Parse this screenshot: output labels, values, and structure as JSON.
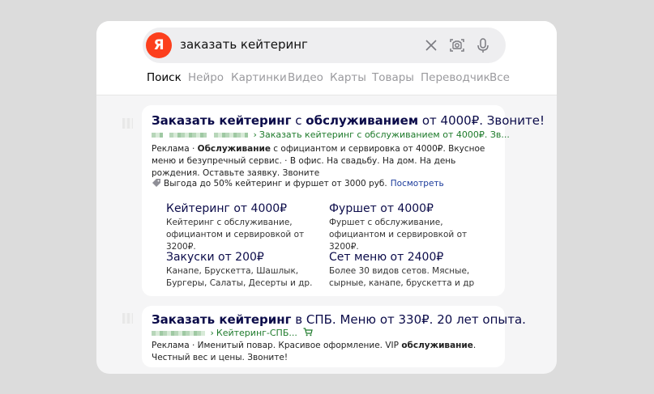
{
  "search": {
    "logo": "Я",
    "query": "заказать кейтеринг"
  },
  "tabs": [
    {
      "label": "Поиск",
      "active": true
    },
    {
      "label": "Нейро"
    },
    {
      "label": "Картинки"
    },
    {
      "label": "Видео"
    },
    {
      "label": "Карты"
    },
    {
      "label": "Товары"
    },
    {
      "label": "Переводчик"
    },
    {
      "label": "Все"
    }
  ],
  "result1": {
    "title_head": "Заказать кейтеринг",
    "title_mid": " с ",
    "title_bold": "обслуживанием",
    "title_tail": " от 4000₽. Звоните!",
    "url_sep": "›",
    "url_path": "Заказать кейтеринг с обслуживанием от 4000₽. Зв...",
    "desc_pre": "Реклама · ",
    "desc_bold": "Обслуживание",
    "desc_post": " с официантом и сервировка от 4000₽. Вкусное меню и безупречный сервис. · В офис. На свадьбу. На дом. На день рождения. Оставьте заявку. Звоните",
    "offer_text": "Выгода до 50% кейтеринг и фуршет от 3000 руб.",
    "offer_link": "Посмотреть",
    "sitelinks": [
      {
        "title": "Кейтеринг от 4000₽",
        "desc": "Кейтеринг с обслуживание, официантом и сервировкой от 3200₽."
      },
      {
        "title": "Фуршет от 4000₽",
        "desc": "Фуршет с обслуживание, официантом и сервировкой от 3200₽."
      },
      {
        "title": "Закуски от 200₽",
        "desc": "Канапе, Брускетта, Шашлык, Бургеры, Салаты, Десерты и др."
      },
      {
        "title": "Сет меню от 2400₽",
        "desc": "Более 30 видов сетов. Мясные, сырные, канапе, брускетта и др"
      }
    ]
  },
  "result2": {
    "title_head": "Заказать кейтеринг",
    "title_tail": " в СПБ. Меню от 330₽. 20 лет опыта.",
    "url_sep": "›",
    "url_path": "Кейтеринг-СПБ...",
    "desc_pre": "Реклама · Именитый повар. Красивое оформление. VIP ",
    "desc_bold": "обслуживание",
    "desc_post": ". Честный вес и цены. Звоните!"
  },
  "colors": {
    "logo": "#fc3f1d",
    "link": "#0c0c4a",
    "url": "#1d7a2a",
    "offer_link": "#1a3a9b"
  }
}
